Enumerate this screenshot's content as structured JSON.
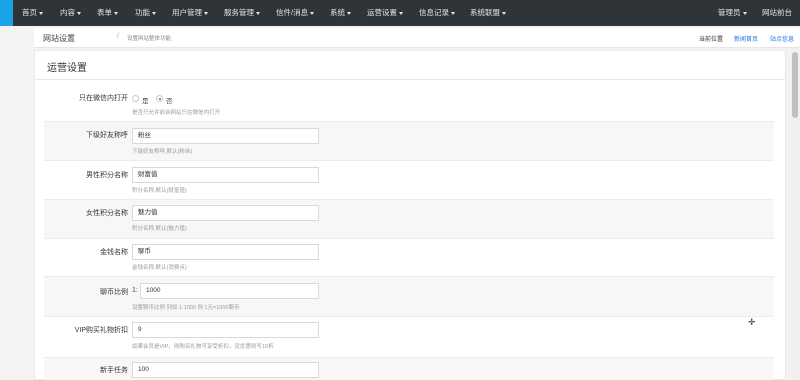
{
  "nav": {
    "items": [
      "首页",
      "内容",
      "表单",
      "功能",
      "用户管理",
      "服务管理",
      "信件/消息",
      "系统",
      "运营设置",
      "信息记录",
      "系统联盟"
    ],
    "admin": "管理员",
    "site": "网站前台"
  },
  "breadcrumb": {
    "title": "网站设置",
    "separator": "/",
    "sub": "设置网站整体功能",
    "current": "当前位置",
    "home": "新闻首页",
    "cache": "站点信息"
  },
  "panel": {
    "title": "运营设置",
    "rows": [
      {
        "label": "只在微信内打开",
        "options": [
          "是",
          "否"
        ],
        "selected": "否",
        "help": "是否只允许前台网站只在微信内打开"
      },
      {
        "label": "下级好友称呼",
        "value": "粉丝",
        "help": "下级好友称呼,默认(粉丝)"
      },
      {
        "label": "男性积分名称",
        "value": "财富值",
        "help": "积分名称,默认(财富值)"
      },
      {
        "label": "女性积分名称",
        "value": "魅力值",
        "help": "积分名称,默认(魅力值)"
      },
      {
        "label": "金钱名称",
        "value": "聊币",
        "help": "金钱名称,默认(消费点)"
      },
      {
        "label": "聊币比例",
        "prefix": "1:",
        "value": "1000",
        "help": "设置聊币比例 列如 1:1000 则 1元=1000聊币"
      },
      {
        "label": "VIP购买礼物折扣",
        "value": "9",
        "help": "如果会员是VIP，则购买礼物可享受折扣，没优惠则写10折"
      },
      {
        "label": "新手任务",
        "value": "100",
        "help": ""
      }
    ]
  },
  "colors": {
    "nav_bg": "#2f3439",
    "accent": "#1aa3e8",
    "link": "#1a73e8"
  }
}
